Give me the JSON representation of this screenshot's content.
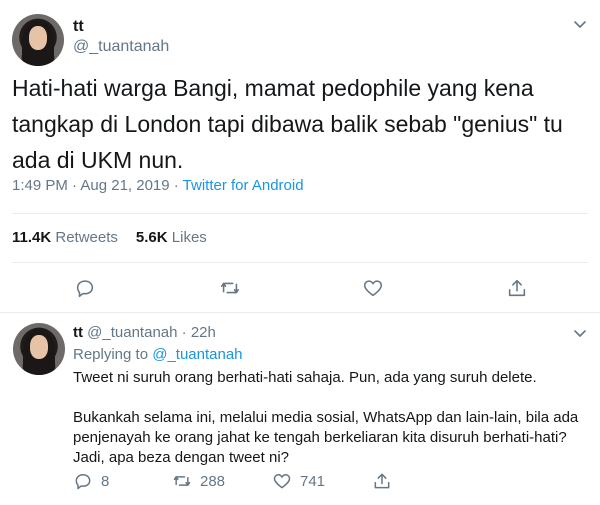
{
  "main_tweet": {
    "name": "tt",
    "handle": "@_tuantanah",
    "text": "Hati-hati warga Bangi, mamat pedophile yang kena tangkap di London tapi dibawa balik sebab \"genius\" tu ada di UKM nun.",
    "time": "1:49 PM · Aug 21, 2019 · ",
    "source": "Twitter for Android",
    "retweets_count": "11.4K",
    "retweets_label": "Retweets",
    "likes_count": "5.6K",
    "likes_label": "Likes",
    "icons": [
      "reply-icon",
      "retweet-icon",
      "like-icon",
      "share-icon",
      "chevron-down-icon"
    ]
  },
  "reply_tweet": {
    "name": "tt",
    "handle": "@_tuantanah",
    "dot": " · ",
    "time": "22h",
    "replying_prefix": "Replying to ",
    "replying_to": "@_tuantanah",
    "paragraph_1": "Tweet ni suruh orang berhati-hati sahaja. Pun, ada yang suruh delete.",
    "paragraph_2": "Bukankah selama ini, melalui media sosial, WhatsApp dan lain-lain, bila ada penjenayah ke orang jahat ke tengah berkeliaran kita disuruh berhati-hati? Jadi, apa beza dengan tweet ni?",
    "reply_count": "8",
    "retweet_count": "288",
    "like_count": "741"
  },
  "colors": {
    "text": "#14171a",
    "muted": "#657786",
    "link": "#1b95e0",
    "border": "#e6ecf0"
  }
}
